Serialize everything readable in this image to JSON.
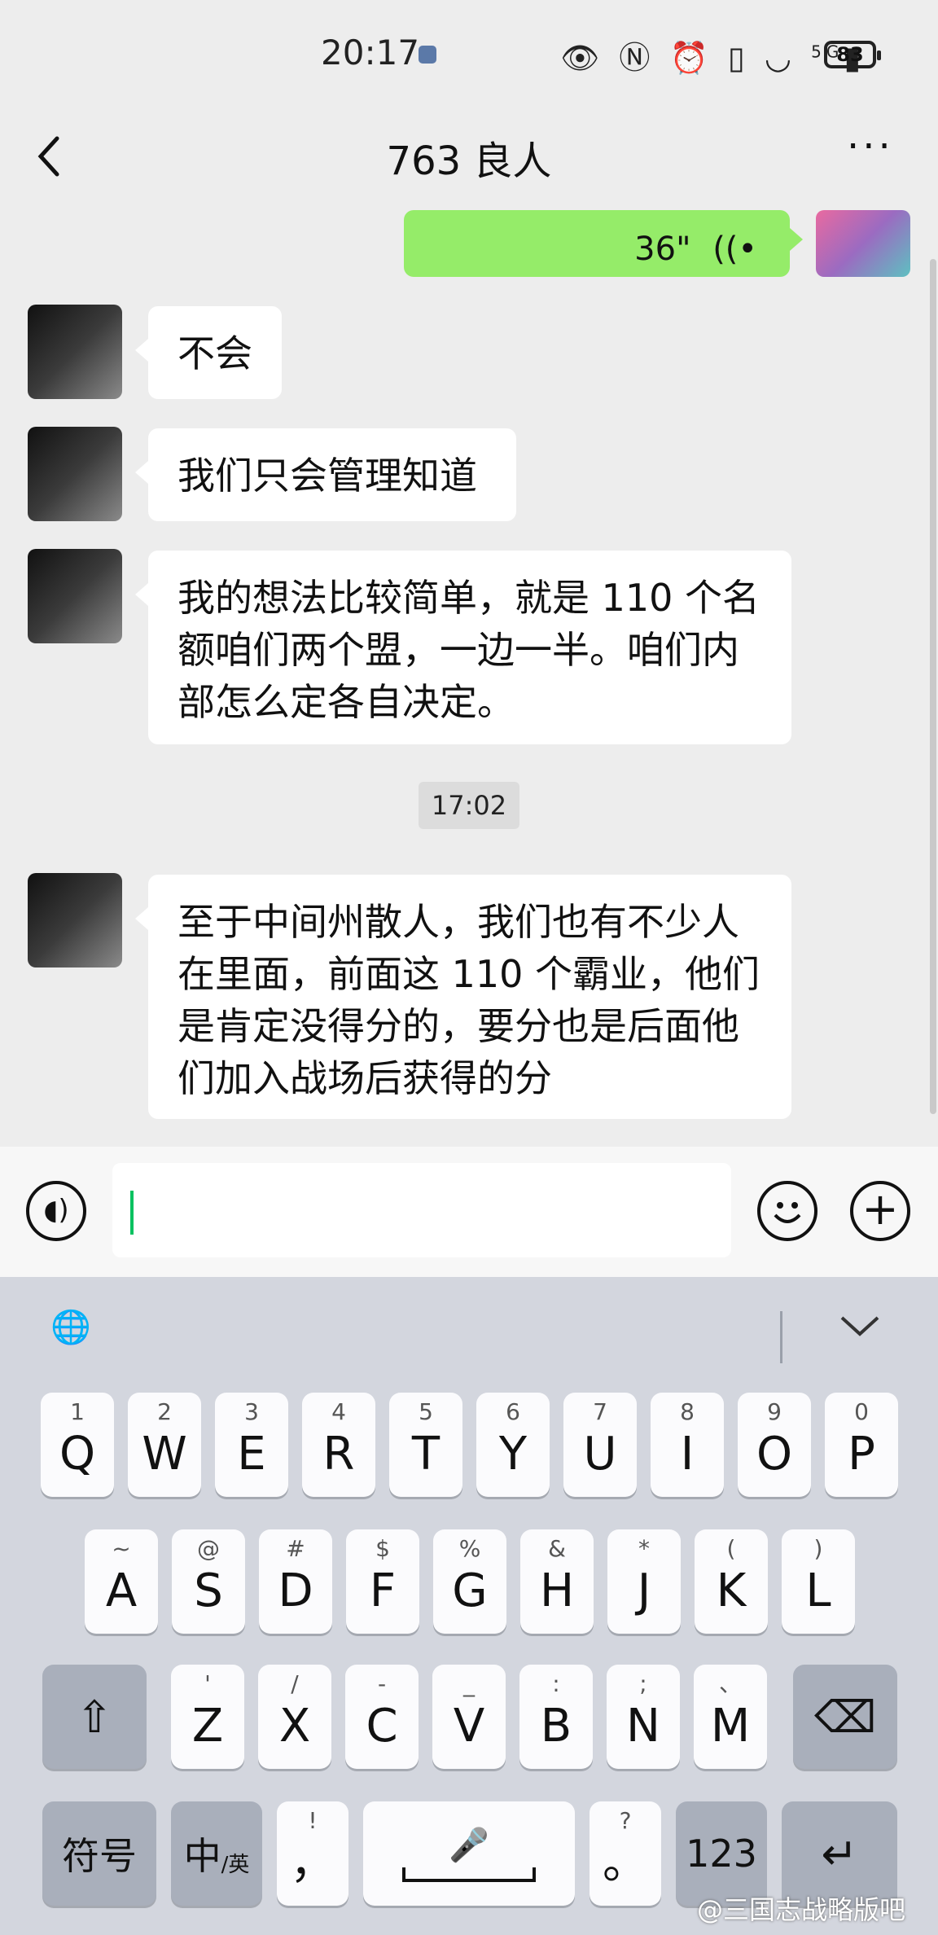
{
  "status_bar": {
    "time": "20:17",
    "battery": "83",
    "icons": [
      "eye-icon",
      "nfc-icon",
      "alarm-icon",
      "vibrate-icon",
      "wifi-icon",
      "5g-signal-icon"
    ],
    "network": "5G"
  },
  "header": {
    "title": "763 良人",
    "back_icon": "chevron-left-icon",
    "more_icon": "ellipsis-icon",
    "more_glyph": "···"
  },
  "messages": [
    {
      "side": "self",
      "type": "voice",
      "duration": "36\"",
      "icon": "voice-wave-icon"
    },
    {
      "side": "other",
      "type": "text",
      "text": "不会"
    },
    {
      "side": "other",
      "type": "text",
      "text": "我们只会管理知道"
    },
    {
      "side": "other",
      "type": "text",
      "text": "我的想法比较简单，就是 110 个名额咱们两个盟，一边一半。咱们内部怎么定各自决定。"
    },
    {
      "side": "other",
      "type": "text",
      "text": "至于中间州散人，我们也有不少人在里面，前面这 110 个霸业，他们是肯定没得分的，要分也是后面他们加入战场后获得的分"
    }
  ],
  "timestamp": "17:02",
  "input_bar": {
    "voice_icon": "voice-mode-icon",
    "emoji_icon": "emoji-icon",
    "plus_icon": "plus-icon",
    "value": ""
  },
  "keyboard": {
    "row1": [
      {
        "main": "Q",
        "sub": "1"
      },
      {
        "main": "W",
        "sub": "2"
      },
      {
        "main": "E",
        "sub": "3"
      },
      {
        "main": "R",
        "sub": "4"
      },
      {
        "main": "T",
        "sub": "5"
      },
      {
        "main": "Y",
        "sub": "6"
      },
      {
        "main": "U",
        "sub": "7"
      },
      {
        "main": "I",
        "sub": "8"
      },
      {
        "main": "O",
        "sub": "9"
      },
      {
        "main": "P",
        "sub": "0"
      }
    ],
    "row2": [
      {
        "main": "A",
        "sub": "~"
      },
      {
        "main": "S",
        "sub": "@"
      },
      {
        "main": "D",
        "sub": "#"
      },
      {
        "main": "F",
        "sub": "$"
      },
      {
        "main": "G",
        "sub": "%"
      },
      {
        "main": "H",
        "sub": "&"
      },
      {
        "main": "J",
        "sub": "*"
      },
      {
        "main": "K",
        "sub": "("
      },
      {
        "main": "L",
        "sub": ")"
      }
    ],
    "row3": [
      {
        "main": "Z",
        "sub": "'"
      },
      {
        "main": "X",
        "sub": "/"
      },
      {
        "main": "C",
        "sub": "-"
      },
      {
        "main": "V",
        "sub": "_"
      },
      {
        "main": "B",
        "sub": ":"
      },
      {
        "main": "N",
        "sub": ";"
      },
      {
        "main": "M",
        "sub": "、"
      }
    ],
    "symbols_label": "符号",
    "lang_label": "中",
    "lang_sub": "/英",
    "comma": "，",
    "comma_sub": "!",
    "period": "。",
    "period_sub": "?",
    "num_label": "123",
    "tool_icons": [
      "keyboard-globe-icon",
      "collapse-keyboard-icon"
    ],
    "glyphs": {
      "shift": "⇧",
      "backspace": "⌫",
      "enter": "↵",
      "mic": "🎤",
      "collapse": "⌄",
      "globe": "🌐"
    }
  },
  "watermark": "@三国志战略版吧"
}
